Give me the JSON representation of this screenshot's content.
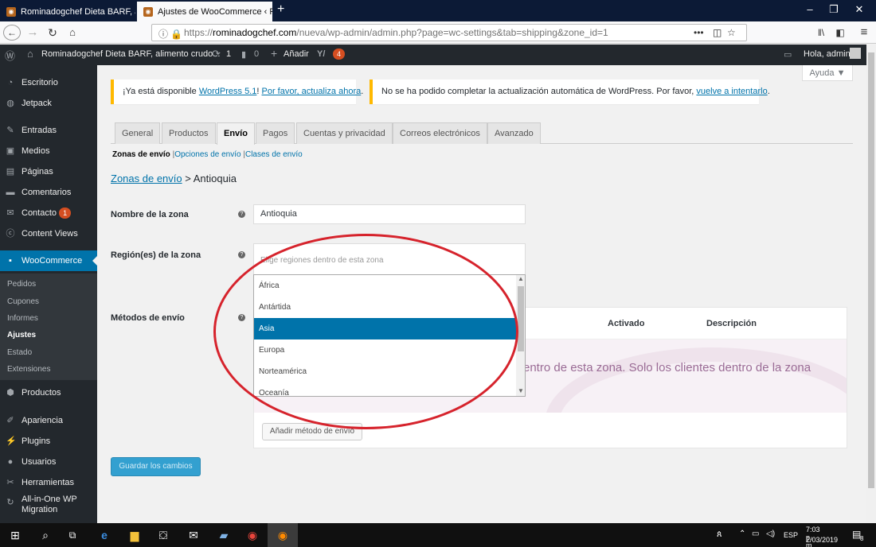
{
  "browser": {
    "tabs": [
      {
        "title": "Rominadogchef Dieta BARF, ali"
      },
      {
        "title": "Ajustes de WooCommerce ‹ Ro"
      }
    ],
    "url_prefix": "https://",
    "url_host": "rominadogchef.com",
    "url_path": "/nueva/wp-admin/admin.php?page=wc-settings&tab=shipping&zone_id=1",
    "url_menu": "•••"
  },
  "adminbar": {
    "site_name": "Rominadogchef Dieta BARF, alimento crudo...",
    "updates": "1",
    "comments": "0",
    "new_label": "Añadir",
    "yoast_count": "4",
    "greeting": "Hola, admin"
  },
  "sidebar": {
    "items": [
      {
        "label": "Escritorio",
        "icon": "dashboard-icon"
      },
      {
        "label": "Jetpack",
        "icon": "jetpack-icon"
      },
      {
        "label": "Entradas",
        "icon": "pin-icon"
      },
      {
        "label": "Medios",
        "icon": "media-icon"
      },
      {
        "label": "Páginas",
        "icon": "pages-icon"
      },
      {
        "label": "Comentarios",
        "icon": "comment-icon"
      },
      {
        "label": "Contacto",
        "icon": "mail-icon",
        "badge": "1"
      },
      {
        "label": "Content Views",
        "icon": "cv-icon"
      },
      {
        "label": "WooCommerce",
        "icon": "woo-icon"
      },
      {
        "label": "Productos",
        "icon": "product-icon"
      },
      {
        "label": "Apariencia",
        "icon": "brush-icon"
      },
      {
        "label": "Plugins",
        "icon": "plugin-icon"
      },
      {
        "label": "Usuarios",
        "icon": "user-icon"
      },
      {
        "label": "Herramientas",
        "icon": "wrench-icon"
      },
      {
        "label": "All-in-One WP Migration",
        "icon": "migration-icon"
      }
    ],
    "submenu": [
      "Pedidos",
      "Cupones",
      "Informes",
      "Ajustes",
      "Estado",
      "Extensiones"
    ]
  },
  "help_label": "Ayuda ▼",
  "notice1": {
    "prefix": "¡Ya está disponible ",
    "link1": "WordPress 5.1",
    "middle": "! ",
    "link2": "Por favor, actualiza ahora",
    "suffix": "."
  },
  "notice2": {
    "prefix": "No se ha podido completar la actualización automática de WordPress. Por favor, ",
    "link": "vuelve a intentarlo",
    "suffix": "."
  },
  "tabs": [
    "General",
    "Productos",
    "Envío",
    "Pagos",
    "Cuentas y privacidad",
    "Correos electrónicos",
    "Avanzado"
  ],
  "subsub": {
    "current": "Zonas de envío",
    "sep": "|",
    "link1": "Opciones de envío",
    "link2": "Clases de envío"
  },
  "heading": {
    "link": "Zonas de envío",
    "rest": " > Antioquia"
  },
  "form": {
    "zone_name_label": "Nombre de la zona",
    "zone_name_value": "Antioquia",
    "region_label": "Región(es) de la zona",
    "region_placeholder": "Elige regiones dentro de esta zona",
    "methods_label": "Métodos de envío"
  },
  "dropdown": {
    "options": [
      "África",
      "Antártida",
      "Asia",
      "Europa",
      "Norteamérica",
      "Oceanía"
    ],
    "selected": "Asia"
  },
  "methods_table": {
    "col_enabled": "Activado",
    "col_description": "Descripción",
    "empty_text": "entro de esta zona. Solo los clientes dentro de la zona",
    "add_button": "Añadir método de envío"
  },
  "save_button": "Guardar los cambios",
  "taskbar": {
    "lang": "ESP",
    "time": "7:03 p. m.",
    "date": "2/03/2019",
    "notif_count": "8"
  },
  "colors": {
    "admin_accent": "#0073aa",
    "notice_border": "#ffb900",
    "annotation_circle": "#d6232c"
  }
}
